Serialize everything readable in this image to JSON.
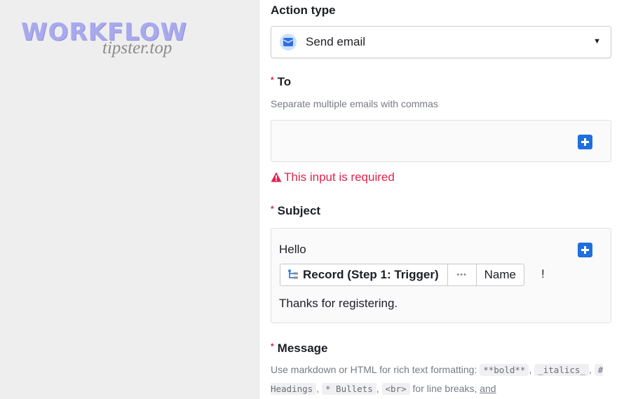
{
  "watermark": {
    "title": "WORKFLOW",
    "subtitle": "tipster.top"
  },
  "action_type": {
    "label": "Action type",
    "value": "Send email",
    "icon": "mail-icon"
  },
  "to": {
    "label": "To",
    "help": "Separate multiple emails with commas",
    "value": "",
    "error": "This input is required"
  },
  "subject": {
    "label": "Subject",
    "line1": "Hello",
    "token": {
      "record": "Record (Step 1: Trigger)",
      "dots": "•••",
      "field": "Name"
    },
    "after_token": "!",
    "line3": "Thanks for registering."
  },
  "message": {
    "label": "Message",
    "help_prefix": "Use markdown or HTML for rich text formatting:",
    "code_bold": "**bold**",
    "code_italics": "_italics_",
    "code_headings": "# Headings",
    "code_bullets": "* Bullets",
    "code_br": "<br>",
    "help_suffix": "for line breaks,",
    "link": "and"
  },
  "colors": {
    "accent": "#1f6fe0",
    "error": "#e0244c",
    "required": "#e0244c"
  }
}
